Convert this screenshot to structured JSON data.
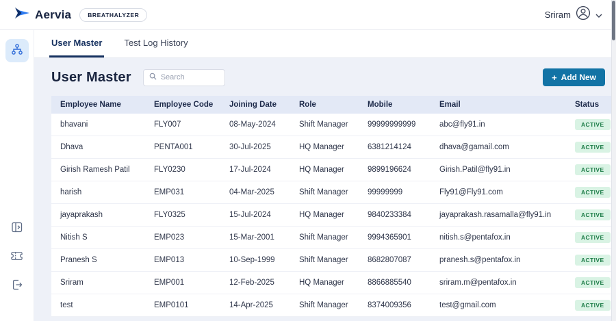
{
  "header": {
    "brand": "Aervia",
    "badge": "BREATHALYZER",
    "user": {
      "name": "Sriram"
    }
  },
  "icons": {
    "logo": "paper-plane-arrow",
    "user": "person-circle",
    "user_menu": "chevron-down",
    "sidebar_top": "org-hierarchy",
    "sidebar_bottom": [
      "panel-exit",
      "ticket",
      "logout"
    ],
    "search": "magnifier",
    "add": "plus"
  },
  "tabs": [
    {
      "label": "User Master",
      "active": true
    },
    {
      "label": "Test Log History",
      "active": false
    }
  ],
  "page": {
    "title": "User Master",
    "search_placeholder": "Search",
    "add_button": "Add New"
  },
  "table": {
    "columns": [
      "Employee Name",
      "Employee Code",
      "Joining Date",
      "Role",
      "Mobile",
      "Email",
      "Status"
    ],
    "rows": [
      [
        "bhavani",
        "FLY007",
        "08-May-2024",
        "Shift Manager",
        "99999999999",
        "abc@fly91.in",
        "ACTIVE"
      ],
      [
        "Dhava",
        "PENTA001",
        "30-Jul-2025",
        "HQ Manager",
        "6381214124",
        "dhava@gamail.com",
        "ACTIVE"
      ],
      [
        "Girish Ramesh Patil",
        "FLY0230",
        "17-Jul-2024",
        "HQ Manager",
        "9899196624",
        "Girish.Patil@fly91.in",
        "ACTIVE"
      ],
      [
        "harish",
        "EMP031",
        "04-Mar-2025",
        "Shift Manager",
        "99999999",
        "Fly91@Fly91.com",
        "ACTIVE"
      ],
      [
        "jayaprakash",
        "FLY0325",
        "15-Jul-2024",
        "HQ Manager",
        "9840233384",
        "jayaprakash.rasamalla@fly91.in",
        "ACTIVE"
      ],
      [
        "Nitish S",
        "EMP023",
        "15-Mar-2001",
        "Shift Manager",
        "9994365901",
        "nitish.s@pentafox.in",
        "ACTIVE"
      ],
      [
        "Pranesh S",
        "EMP013",
        "10-Sep-1999",
        "Shift Manager",
        "8682807087",
        "pranesh.s@pentafox.in",
        "ACTIVE"
      ],
      [
        "Sriram",
        "EMP001",
        "12-Feb-2025",
        "HQ Manager",
        "8866885540",
        "sriram.m@pentafox.in",
        "ACTIVE"
      ],
      [
        "test",
        "EMP0101",
        "14-Apr-2025",
        "Shift Manager",
        "8374009356",
        "test@gmail.com",
        "ACTIVE"
      ]
    ]
  },
  "colors": {
    "accent_button": "#1273a5",
    "tab_active": "#15305f",
    "table_header_bg": "#e3e9f6",
    "badge_bg": "#d9f3e4",
    "badge_text": "#1b7b46",
    "page_bg": "#eef1f8"
  }
}
